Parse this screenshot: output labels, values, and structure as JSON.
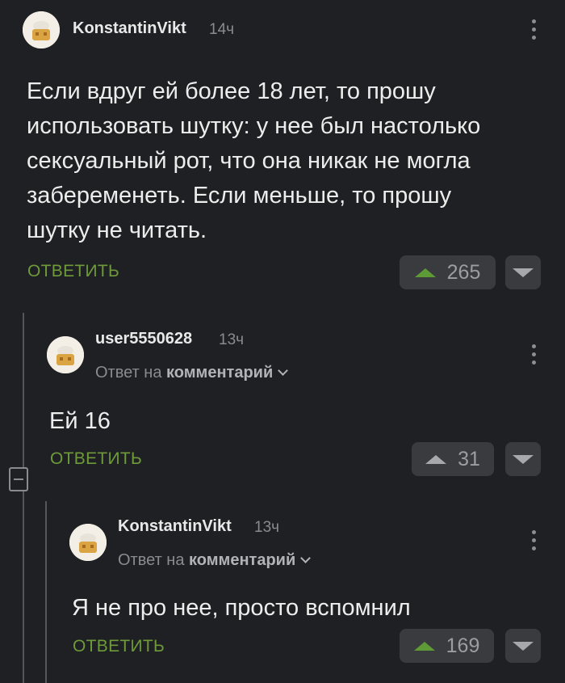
{
  "comments": [
    {
      "username": "KonstantinVikt",
      "time": "14ч",
      "text_lines": [
        "Если вдруг ей более 18 лет, то прошу",
        "использовать шутку: у нее был настолько",
        "сексуальный рот, что она никак не могла",
        "забеременеть. Если меньше, то прошу",
        "шутку не читать."
      ],
      "reply_label": "ОТВЕТИТЬ",
      "rating": "265",
      "upvoted": true
    },
    {
      "username": "user5550628",
      "time": "13ч",
      "reply_to_prefix": "Ответ на",
      "reply_to_target": "комментарий",
      "text_lines": [
        "Ей 16"
      ],
      "reply_label": "ОТВЕТИТЬ",
      "rating": "31",
      "upvoted": false
    },
    {
      "username": "KonstantinVikt",
      "time": "13ч",
      "reply_to_prefix": "Ответ на",
      "reply_to_target": "комментарий",
      "text_lines": [
        "Я не про нее, просто вспомнил"
      ],
      "reply_label": "ОТВЕТИТЬ",
      "rating": "169",
      "upvoted": true
    }
  ],
  "colors": {
    "background": "#1f2023",
    "accent_green": "#6e9a3a",
    "vote_button": "#3a3b3f"
  },
  "icons": [
    "avatar-icon",
    "kebab-menu-icon",
    "upvote-arrow-icon",
    "downvote-arrow-icon",
    "collapse-thread-icon",
    "chevron-down-icon"
  ]
}
